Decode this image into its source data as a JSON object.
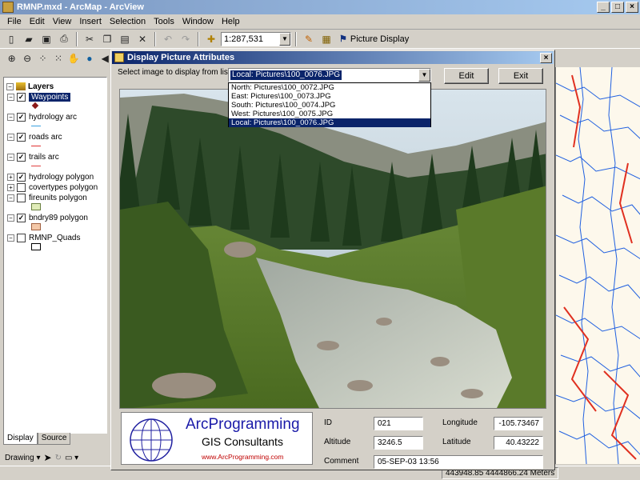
{
  "window": {
    "title": "RMNP.mxd - ArcMap - ArcView"
  },
  "menubar": {
    "items": [
      "File",
      "Edit",
      "View",
      "Insert",
      "Selection",
      "Tools",
      "Window",
      "Help"
    ]
  },
  "toolbar": {
    "scale_value": "1:287,531",
    "picture_display_label": "Picture Display"
  },
  "toc": {
    "root_label": "Layers",
    "layers": [
      {
        "label": "Waypoints",
        "checked": true,
        "selected": true
      },
      {
        "label": "hydrology arc",
        "checked": true
      },
      {
        "label": "roads arc",
        "checked": true
      },
      {
        "label": "trails arc",
        "checked": true
      },
      {
        "label": "hydrology polygon",
        "checked": true
      },
      {
        "label": "covertypes polygon",
        "checked": false
      },
      {
        "label": "fireunits polygon",
        "checked": false
      },
      {
        "label": "bndry89 polygon",
        "checked": true
      },
      {
        "label": "RMNP_Quads",
        "checked": false
      }
    ],
    "tabs": [
      "Display",
      "Source"
    ]
  },
  "drawing": {
    "label": "Drawing"
  },
  "dialog": {
    "title": "Display Picture Attributes",
    "select_label": "Select image to display from list:",
    "selected_image": "Local: Pictures\\100_0076.JPG",
    "image_options": [
      "North: Pictures\\100_0072.JPG",
      "East: Pictures\\100_0073.JPG",
      "South: Pictures\\100_0074.JPG",
      "West: Pictures\\100_0075.JPG",
      "Local: Pictures\\100_0076.JPG"
    ],
    "edit_label": "Edit",
    "exit_label": "Exit",
    "logo": {
      "title": "ArcProgramming",
      "subtitle": "GIS Consultants",
      "url": "www.ArcProgramming.com"
    },
    "fields": {
      "id_label": "ID",
      "id_value": "021",
      "longitude_label": "Longitude",
      "longitude_value": "-105.73467",
      "altitude_label": "Altitude",
      "altitude_value": "3246.5",
      "latitude_label": "Latitude",
      "latitude_value": "40.43222",
      "comment_label": "Comment",
      "comment_value": "05-SEP-03 13:56"
    }
  },
  "status": {
    "coords": "443948.85  4444866.24 Meters"
  }
}
